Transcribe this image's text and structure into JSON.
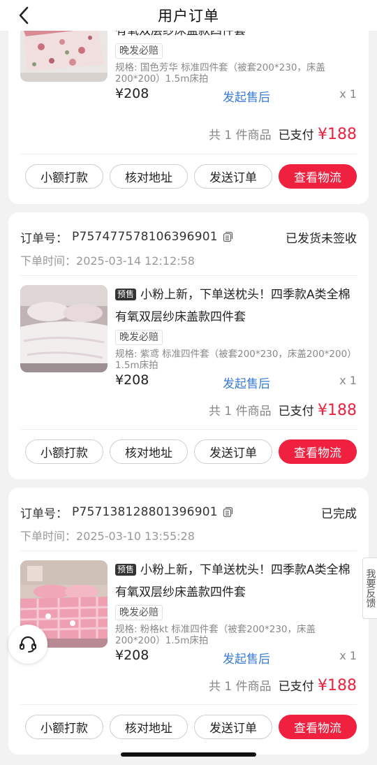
{
  "header": {
    "title": "用户订单"
  },
  "labels": {
    "order_no": "订单号：",
    "order_time": "下单时间：",
    "presale": "预售",
    "aftersale": "发起售后",
    "paid": "已支付",
    "currency": "¥"
  },
  "orders": [
    {
      "product_name_line2": "有氧双层纱床盖款四件套",
      "tag": "晚发必赔",
      "spec": "规格: 国色芳华 标准四件套（被套200*230，床盖200*200）1.5m床拍",
      "price": "¥208",
      "qty": "x 1",
      "count_text": "共 1 件商品",
      "paid_amount": "¥188",
      "buttons": [
        "小额打款",
        "核对地址",
        "发送订单",
        "查看物流"
      ]
    },
    {
      "order_no": "P757477578106396901",
      "status": "已发货未签收",
      "time": "2025-03-14 12:12:58",
      "product_name_line1": "小粉上新，下单送枕头！四季款A类全棉",
      "product_name_line2": "有氧双层纱床盖款四件套",
      "tag": "晚发必赔",
      "spec": "规格: 紫鸢 标准四件套（被套200*230，床盖200*200）1.5m床拍",
      "price": "¥208",
      "qty": "x 1",
      "count_text": "共 1 件商品",
      "paid_amount": "¥188",
      "buttons": [
        "小额打款",
        "核对地址",
        "发送订单",
        "查看物流"
      ]
    },
    {
      "order_no": "P757138128801396901",
      "status": "已完成",
      "time": "2025-03-10 13:55:28",
      "product_name_line1": "小粉上新，下单送枕头！四季款A类全棉",
      "product_name_line2": "有氧双层纱床盖款四件套",
      "tag": "晚发必赔",
      "spec": "规格: 粉格kt 标准四件套（被套200*230，床盖200*200）1.5m床拍",
      "price": "¥208",
      "qty": "x 1",
      "count_text": "共 1 件商品",
      "paid_amount": "¥188",
      "buttons": [
        "小额打款",
        "核对地址",
        "发送订单",
        "查看物流"
      ]
    }
  ],
  "side": {
    "feedback": "我要反馈"
  },
  "icons": [
    "back-arrow-icon",
    "copy-icon",
    "customer-service-icon"
  ],
  "colors": {
    "accent": "#f0213f",
    "link": "#3a7bd5"
  }
}
